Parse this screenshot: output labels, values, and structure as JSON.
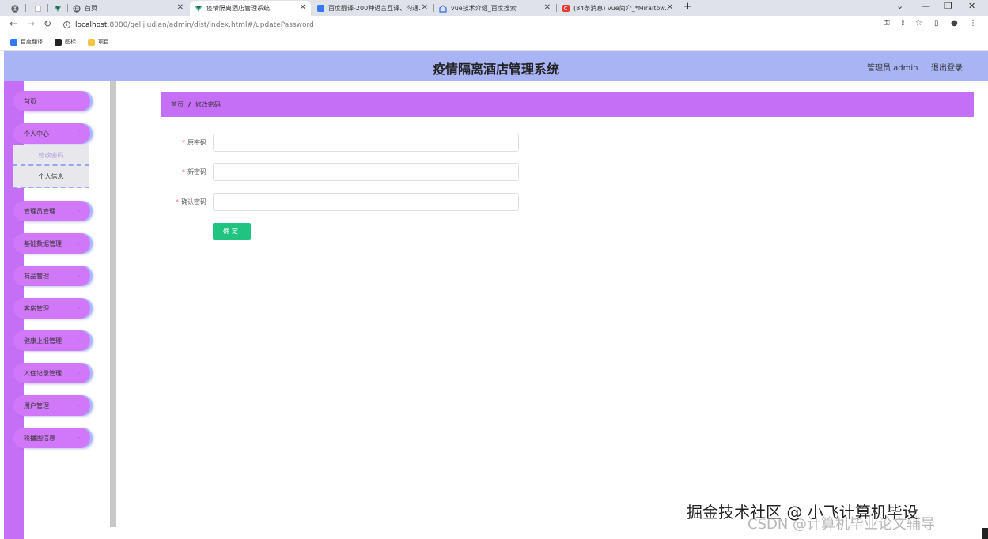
{
  "browser": {
    "tabs": [
      {
        "label": "",
        "icon": "globe-icon"
      },
      {
        "label": "",
        "icon": "blank-page-icon"
      },
      {
        "label": "",
        "icon": "vue-logo-icon"
      },
      {
        "label": "首页",
        "icon": "globe-icon"
      },
      {
        "label": "疫情隔离酒店管理系统",
        "icon": "vue-logo-icon",
        "active": true
      },
      {
        "label": "百度翻译-200种语言互译、沟通...",
        "icon": "baidu-translate-icon"
      },
      {
        "label": "vue技术介绍_百度搜索",
        "icon": "baidu-search-icon"
      },
      {
        "label": "(84条消息) vue简介_*Miraitow...",
        "icon": "csdn-icon"
      }
    ],
    "url_host": "localhost",
    "url_path": ":8080/gelijiudian/admin/dist/index.html#/updatePassword",
    "bookmarks": [
      "百度翻译",
      "图标",
      "项目"
    ]
  },
  "header": {
    "title": "疫情隔离酒店管理系统",
    "user": "管理员 admin",
    "logout": "退出登录"
  },
  "sidebar": {
    "items": [
      {
        "label": "首页"
      },
      {
        "label": "个人中心"
      },
      {
        "label": "管理员管理"
      },
      {
        "label": "基础数据管理"
      },
      {
        "label": "商品管理"
      },
      {
        "label": "客房管理"
      },
      {
        "label": "健康上报管理"
      },
      {
        "label": "入住记录管理"
      },
      {
        "label": "用户管理"
      },
      {
        "label": "轮播图信息"
      }
    ],
    "submenu": [
      "修改密码",
      "个人信息"
    ]
  },
  "breadcrumb": {
    "home": "首页",
    "separator": "/",
    "current": "修改密码"
  },
  "form": {
    "required_mark": "*",
    "old_password_label": "原密码",
    "new_password_label": "新密码",
    "confirm_password_label": "确认密码",
    "submit": "确定"
  },
  "watermark": {
    "line1": "掘金技术社区 @ 小飞计算机毕设",
    "line2": "CSDN @计算机毕业论文辅导"
  },
  "colors": {
    "header_bg": "#a9b4f4",
    "menu_bg": "#d078f7",
    "breadcrumb_bg": "#c56ff7",
    "button_bg": "#1ec47f",
    "required": "#f56c6c"
  }
}
